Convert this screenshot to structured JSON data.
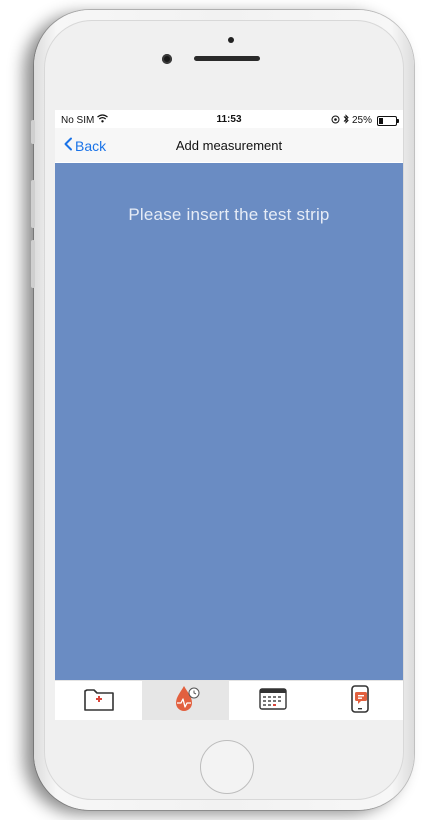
{
  "status_bar": {
    "carrier": "No SIM",
    "time": "11:53",
    "battery_text": "25%",
    "battery_level": 0.25
  },
  "nav": {
    "back_label": "Back",
    "title": "Add measurement"
  },
  "content": {
    "prompt": "Please insert the test strip",
    "background_color": "#6a8cc3"
  },
  "tabs": [
    {
      "icon": "medical-folder-icon",
      "active": false
    },
    {
      "icon": "blood-drop-measure-icon",
      "active": true
    },
    {
      "icon": "calendar-icon",
      "active": false
    },
    {
      "icon": "phone-message-icon",
      "active": false
    }
  ],
  "colors": {
    "accent": "#1a73e8",
    "brand_orange": "#e2603f"
  }
}
